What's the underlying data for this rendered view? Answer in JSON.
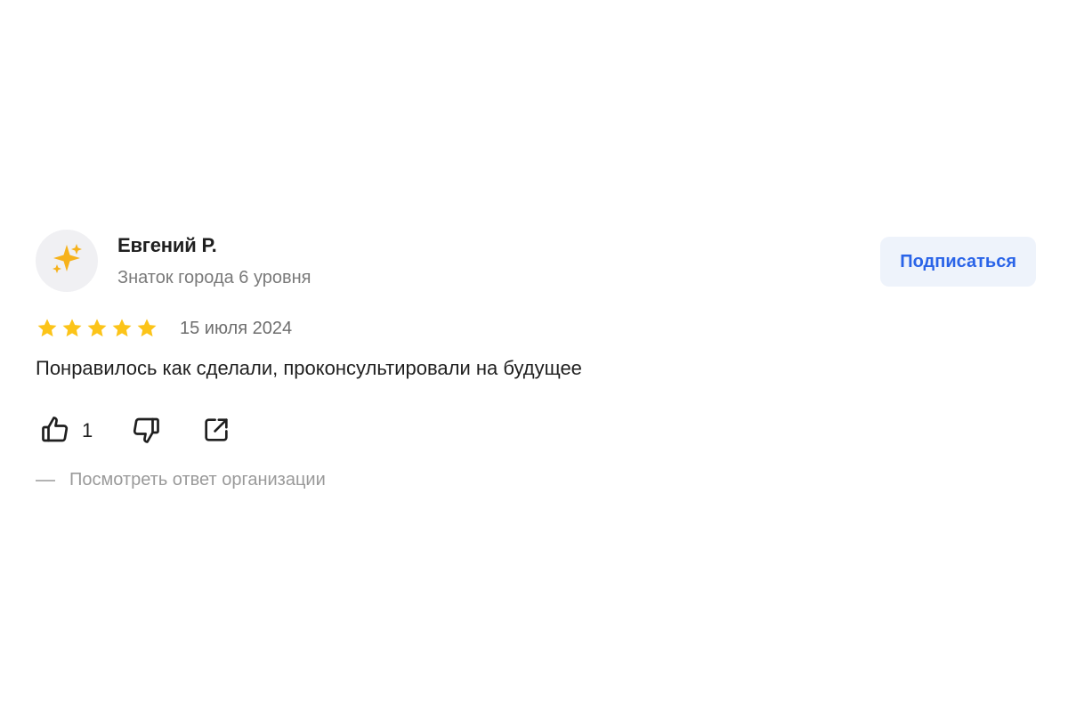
{
  "review": {
    "author": {
      "name": "Евгений Р.",
      "level": "Знаток города 6 уровня",
      "avatar_icon": "sparkles-icon"
    },
    "subscribe_label": "Подписаться",
    "rating": 5,
    "rating_max": 5,
    "date": "15 июля 2024",
    "text": "Понравилось как сделали, проконсультировали на будущее",
    "likes": "1",
    "org_reply_label": "Посмотреть ответ организации",
    "colors": {
      "accent": "#2a64e8",
      "star": "#fcc419"
    }
  }
}
